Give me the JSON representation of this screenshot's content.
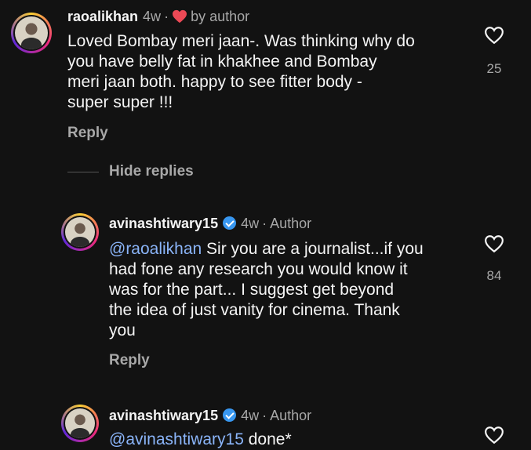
{
  "comments": [
    {
      "username": "raoalikhan",
      "time": "4w",
      "separator": "·",
      "author_badge": "by author",
      "lines": [
        "Loved Bombay meri jaan-. Was thinking why do",
        "you  have belly fat in khakhee and Bombay",
        "meri jaan both.  happy to see fitter body -",
        "super super !!!"
      ],
      "reply_label": "Reply",
      "likes": "25"
    }
  ],
  "hide_replies_label": "Hide replies",
  "replies": [
    {
      "username": "avinashtiwary15",
      "time": "4w",
      "separator": "·",
      "author_label": "Author",
      "mention": "@raoalikhan",
      "lines": [
        " Sir you are a journalist...if you",
        "had fone any research you would know it",
        "was for the part... I suggest get beyond",
        "the idea of just vanity for cinema. Thank",
        "you"
      ],
      "reply_label": "Reply",
      "likes": "84"
    },
    {
      "username": "avinashtiwary15",
      "time": "4w",
      "separator": "·",
      "author_label": "Author",
      "mention": "@avinashtiwary15",
      "lines": [
        " done*"
      ]
    }
  ],
  "colors": {
    "background": "#121212",
    "text": "#f5f5f5",
    "secondary": "#a8a8a8",
    "mention": "#8ab4f8",
    "verified": "#3897f0",
    "heart": "#ed4956"
  }
}
